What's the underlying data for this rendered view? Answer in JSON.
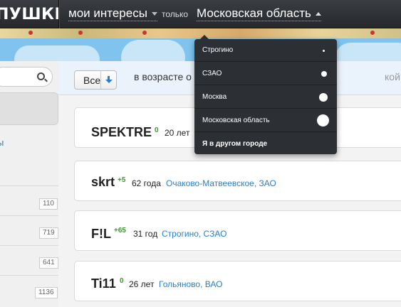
{
  "header": {
    "logo_text": "ПУШКИН",
    "interests_label": "мои интересы",
    "only_label": "только",
    "region_label": "Московская область"
  },
  "sidebar": {
    "link_text": "ы",
    "counts": [
      "110",
      "719",
      "641",
      "1136"
    ]
  },
  "filter": {
    "select_value": "Все",
    "age_text": "в возрасте о",
    "age_text_tail": "кой"
  },
  "users": [
    {
      "name": "SPEKTRE",
      "karma": "0",
      "age": "20 лет",
      "location": ""
    },
    {
      "name": "skrt",
      "karma": "+5",
      "age": "62 года",
      "location": "Очаково-Матвеевское, ЗАО"
    },
    {
      "name": "F!L",
      "karma": "+65",
      "age": "31 год",
      "location": "Строгино, СЗАО"
    },
    {
      "name": "Ti11",
      "karma": "0",
      "age": "26 лет",
      "location": "Гольяново, ВАО"
    }
  ],
  "region_menu": {
    "items": [
      {
        "label": "Строгино"
      },
      {
        "label": "СЗАО"
      },
      {
        "label": "Москва"
      },
      {
        "label": "Московская область"
      },
      {
        "label": "Я в другом городе"
      }
    ]
  },
  "colors": {
    "topbar": "#2f3237",
    "link": "#2a7fc8",
    "karma": "#3a9a2e",
    "sky": "#7fc3ee",
    "dropdown": "#2c2f33"
  }
}
